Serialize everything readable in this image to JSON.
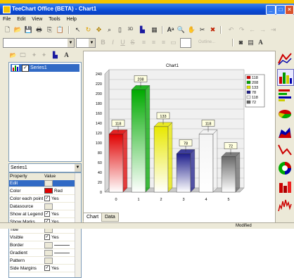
{
  "window": {
    "title": "TeeChart Office (BETA) - Chart1"
  },
  "menu": [
    "File",
    "Edit",
    "View",
    "Tools",
    "Help"
  ],
  "toolbar2": {
    "font_combo": "",
    "outline_label": "Outline..."
  },
  "series_list": {
    "items": [
      {
        "label": "Series1",
        "checked": true
      }
    ]
  },
  "series_selector": {
    "value": "Series1"
  },
  "properties": {
    "header": {
      "property": "Property",
      "value": "Value"
    },
    "rows": [
      {
        "name": "Edit",
        "value": "",
        "kind": "ellipsis",
        "selected": true
      },
      {
        "name": "Color",
        "value": "Red",
        "kind": "color",
        "color": "#e00000"
      },
      {
        "name": "Color each point",
        "value": "Yes",
        "kind": "check"
      },
      {
        "name": "Datasource",
        "value": "",
        "kind": "ellipsis"
      },
      {
        "name": "Show at Legend",
        "value": "Yes",
        "kind": "check"
      },
      {
        "name": "Show Marks",
        "value": "Yes",
        "kind": "check"
      },
      {
        "name": "Title",
        "value": "",
        "kind": "ellipsis"
      },
      {
        "name": "Visible",
        "value": "Yes",
        "kind": "check"
      },
      {
        "name": "Border",
        "value": "",
        "kind": "line"
      },
      {
        "name": "Gradient",
        "value": "",
        "kind": "line"
      },
      {
        "name": "Pattern",
        "value": "",
        "kind": "ellipsis"
      },
      {
        "name": "Side Margins",
        "value": "Yes",
        "kind": "check"
      }
    ]
  },
  "tabs": [
    "Chart",
    "Data"
  ],
  "status": {
    "modified": "Modified"
  },
  "chart_data": {
    "type": "bar",
    "title": "Chart1",
    "categories": [
      "0",
      "1",
      "2",
      "3",
      "4",
      "5"
    ],
    "values": [
      118,
      208,
      133,
      78,
      118,
      72
    ],
    "colors": [
      "#e00000",
      "#00aa00",
      "#e8e800",
      "#1e1e8c",
      "#f4f4f4",
      "#6a6a6a"
    ],
    "ylim": [
      0,
      240
    ],
    "yticks": [
      0,
      20,
      40,
      60,
      80,
      100,
      120,
      140,
      160,
      180,
      200,
      220,
      240
    ],
    "legend": {
      "placement": "right",
      "entries": [
        "118",
        "208",
        "133",
        "78",
        "118",
        "72"
      ]
    },
    "marks": true,
    "grid": true
  }
}
